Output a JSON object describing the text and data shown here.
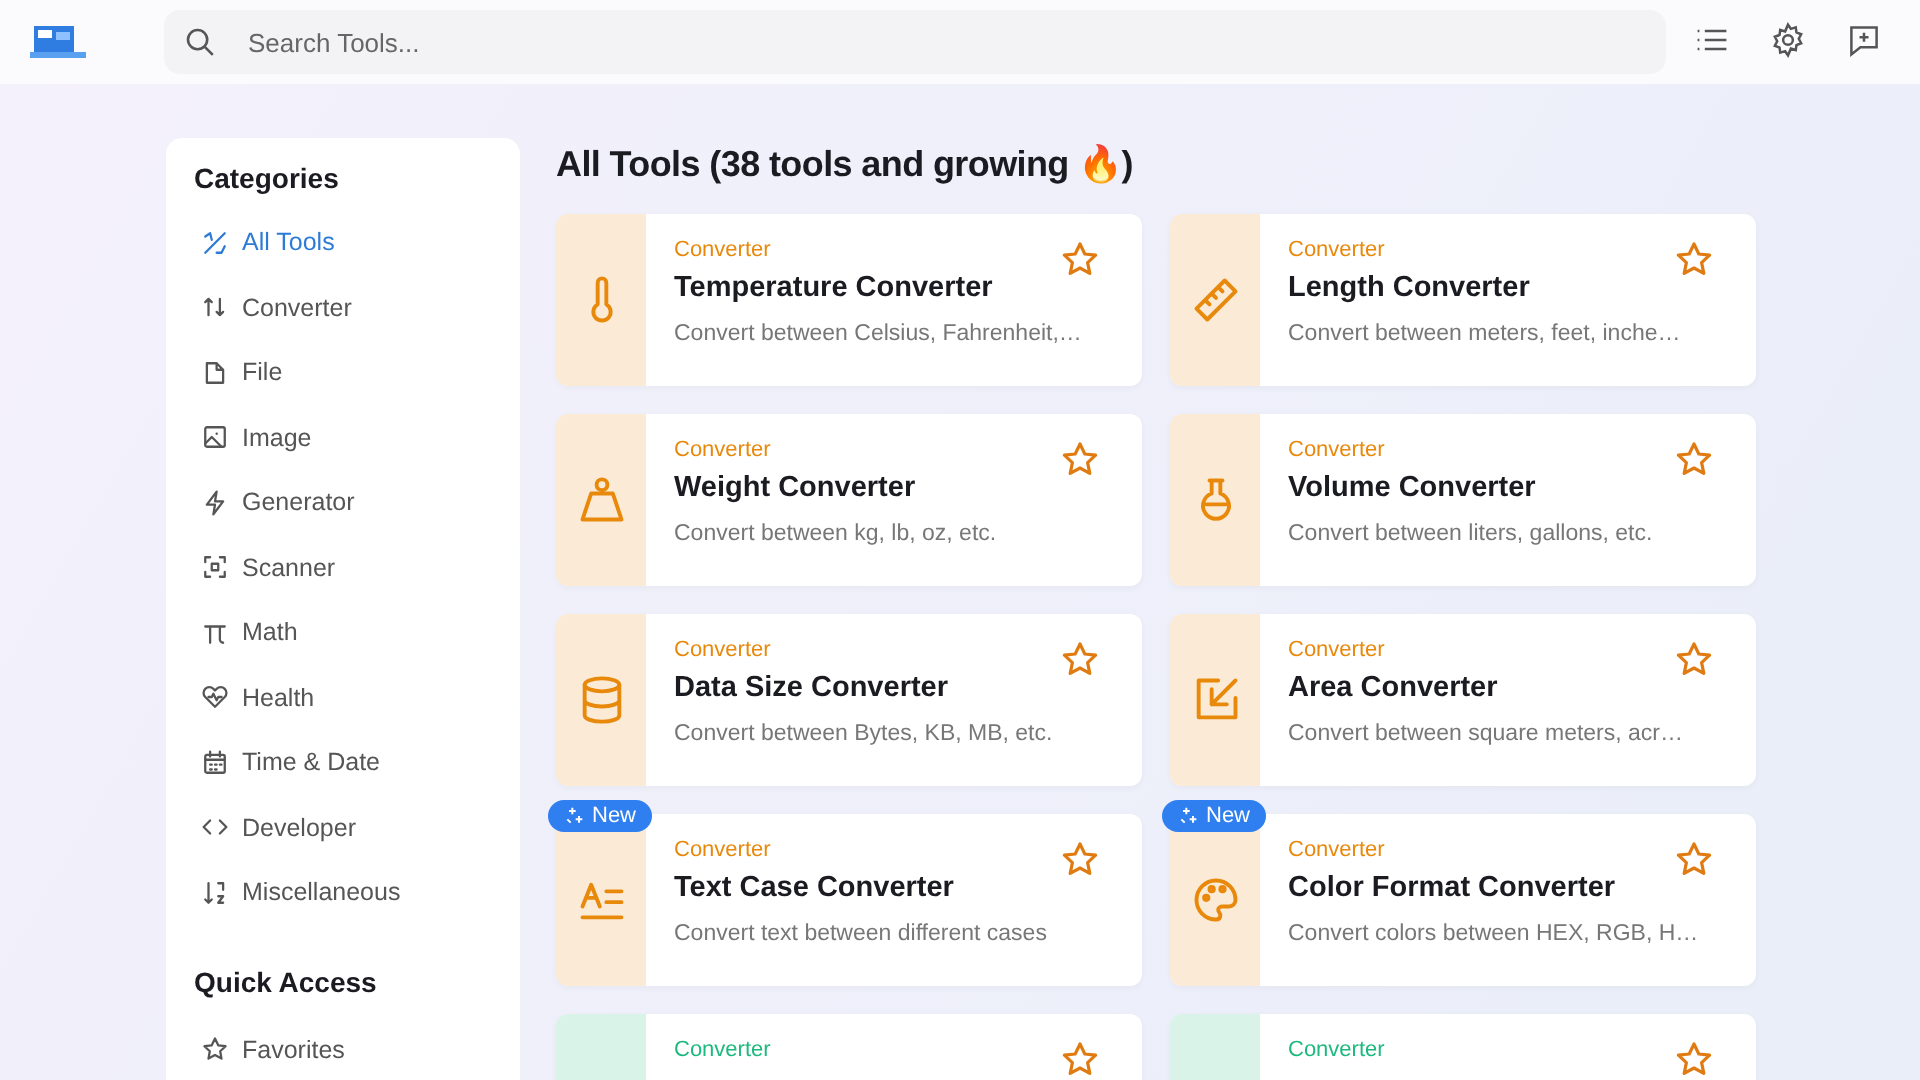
{
  "header": {
    "search": {
      "placeholder": "Search Tools..."
    }
  },
  "sidebar": {
    "categories_title": "Categories",
    "categories": [
      {
        "label": "All Tools",
        "kind": "all",
        "selected": true
      },
      {
        "label": "Converter",
        "kind": "converter",
        "selected": false
      },
      {
        "label": "File",
        "kind": "file",
        "selected": false
      },
      {
        "label": "Image",
        "kind": "image",
        "selected": false
      },
      {
        "label": "Generator",
        "kind": "generator",
        "selected": false
      },
      {
        "label": "Scanner",
        "kind": "scanner",
        "selected": false
      },
      {
        "label": "Math",
        "kind": "math",
        "selected": false
      },
      {
        "label": "Health",
        "kind": "health",
        "selected": false
      },
      {
        "label": "Time & Date",
        "kind": "time",
        "selected": false
      },
      {
        "label": "Developer",
        "kind": "developer",
        "selected": false
      },
      {
        "label": "Miscellaneous",
        "kind": "misc",
        "selected": false
      }
    ],
    "quick_access_title": "Quick Access",
    "quick_access": [
      {
        "label": "Favorites",
        "kind": "favorites",
        "selected": false
      }
    ]
  },
  "main": {
    "title": "All Tools (38 tools and growing 🔥)",
    "tools": [
      {
        "category": "Converter",
        "color": "#e8890c",
        "kind": "thermometer",
        "name": "Temperature Converter",
        "description": "Convert between Celsius, Fahrenheit,…",
        "new": false
      },
      {
        "category": "Converter",
        "color": "#e8890c",
        "kind": "ruler",
        "name": "Length Converter",
        "description": "Convert between meters, feet, inche…",
        "new": false
      },
      {
        "category": "Converter",
        "color": "#e8890c",
        "kind": "weight",
        "name": "Weight Converter",
        "description": "Convert between kg, lb, oz, etc.",
        "new": false
      },
      {
        "category": "Converter",
        "color": "#e8890c",
        "kind": "flask",
        "name": "Volume Converter",
        "description": "Convert between liters, gallons, etc.",
        "new": false
      },
      {
        "category": "Converter",
        "color": "#e8890c",
        "kind": "database",
        "name": "Data Size Converter",
        "description": "Convert between Bytes, KB, MB, etc.",
        "new": false
      },
      {
        "category": "Converter",
        "color": "#e8890c",
        "kind": "arrow",
        "name": "Area Converter",
        "description": "Convert between square meters, acr…",
        "new": false
      },
      {
        "category": "Converter",
        "color": "#e8890c",
        "kind": "textcase",
        "name": "Text Case Converter",
        "description": "Convert text between different cases",
        "new": true,
        "badge": "New"
      },
      {
        "category": "Converter",
        "color": "#e8890c",
        "kind": "palette",
        "name": "Color Format Converter",
        "description": "Convert colors between HEX, RGB, H…",
        "new": true,
        "badge": "New"
      },
      {
        "category": "Converter",
        "color": "#1db97f",
        "new": false
      },
      {
        "category": "Converter",
        "color": "#1db97f",
        "new": false
      }
    ]
  }
}
